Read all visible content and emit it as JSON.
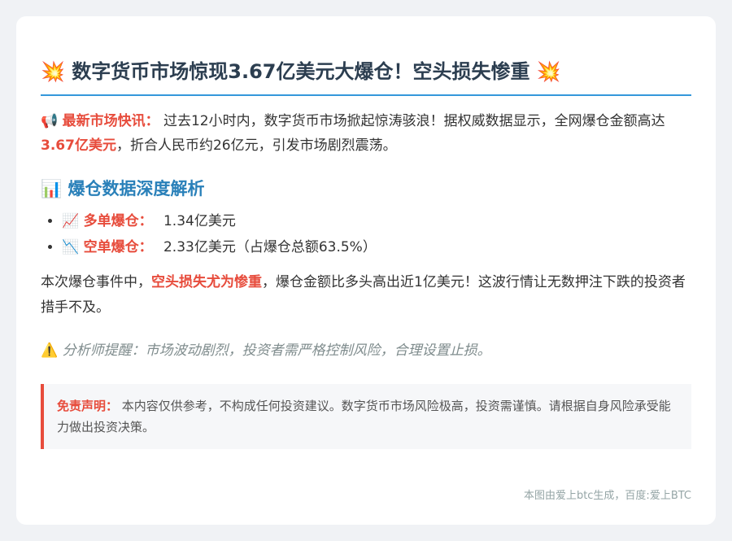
{
  "title": {
    "icon_left": "💥",
    "text": "数字货币市场惊现3.67亿美元大爆仓！空头损失惨重",
    "icon_right": "💥"
  },
  "flash": {
    "icon": "📢",
    "label": "最新市场快讯：",
    "text1": "过去12小时内，数字货币市场掀起惊涛骇浪！据权威数据显示，全网爆仓金额高达",
    "amount": "3.67亿美元",
    "text2": "，折合人民币约26亿元，引发市场剧烈震荡。"
  },
  "analysis": {
    "icon": "📊",
    "title": "爆仓数据深度解析",
    "items": [
      {
        "icon": "📈",
        "label": "多单爆仓：",
        "value": "1.34亿美元"
      },
      {
        "icon": "📉",
        "label": "空单爆仓：",
        "value": "2.33亿美元（占爆仓总额63.5%）"
      }
    ]
  },
  "summary": {
    "text1": "本次爆仓事件中，",
    "highlight": "空头损失尤为惨重",
    "text2": "，爆仓金额比多头高出近1亿美元！这波行情让无数押注下跌的投资者措手不及。"
  },
  "warning": {
    "icon": "⚠️",
    "text": "分析师提醒：市场波动剧烈，投资者需严格控制风险，合理设置止损。"
  },
  "disclaimer": {
    "label": "免责声明：",
    "text": "本内容仅供参考，不构成任何投资建议。数字货币市场风险极高，投资需谨慎。请根据自身风险承受能力做出投资决策。"
  },
  "footer": {
    "text": "本图由爱上btc生成，百度:爱上BTC"
  },
  "colors": {
    "accent_blue": "#3498db",
    "highlight_red": "#e74c3c",
    "section_blue": "#2980b9"
  }
}
